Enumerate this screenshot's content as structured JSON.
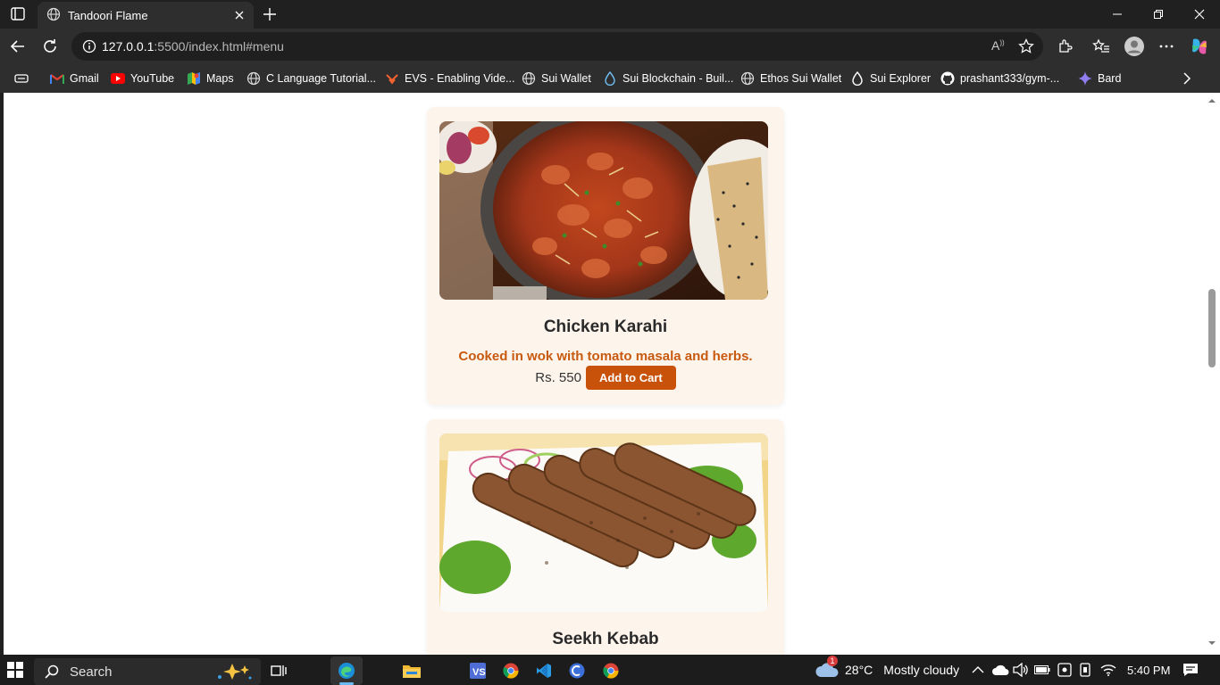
{
  "browser": {
    "tab_title": "Tandoori Flame",
    "url_host": "127.0.0.1",
    "url_path": ":5500/index.html#menu"
  },
  "bookmarks": [
    {
      "label": "Gmail",
      "icon": "gmail-icon"
    },
    {
      "label": "YouTube",
      "icon": "youtube-icon"
    },
    {
      "label": "Maps",
      "icon": "maps-icon"
    },
    {
      "label": "C Language Tutorial...",
      "icon": "globe-icon"
    },
    {
      "label": "EVS - Enabling Vide...",
      "icon": "evs-icon"
    },
    {
      "label": "Sui Wallet",
      "icon": "globe-icon"
    },
    {
      "label": "Sui Blockchain - Buil...",
      "icon": "sui-drop-icon"
    },
    {
      "label": "Ethos Sui Wallet",
      "icon": "globe-icon"
    },
    {
      "label": "Sui Explorer",
      "icon": "sui-drop-icon"
    },
    {
      "label": "prashant333/gym-...",
      "icon": "github-icon"
    },
    {
      "label": "Bard",
      "icon": "bard-icon"
    }
  ],
  "menu": {
    "items": [
      {
        "name": "Chicken Karahi",
        "description": "Cooked in wok with tomato masala and herbs.",
        "price": "Rs. 550",
        "button": "Add to Cart"
      },
      {
        "name": "Seekh Kebab"
      }
    ]
  },
  "taskbar": {
    "search_placeholder": "Search",
    "weather_temp": "28°C",
    "weather_text": "Mostly cloudy",
    "weather_badge": "1",
    "time": "5:40 PM"
  },
  "colors": {
    "accent": "#c8520a",
    "card_bg": "#fdf4ec"
  }
}
